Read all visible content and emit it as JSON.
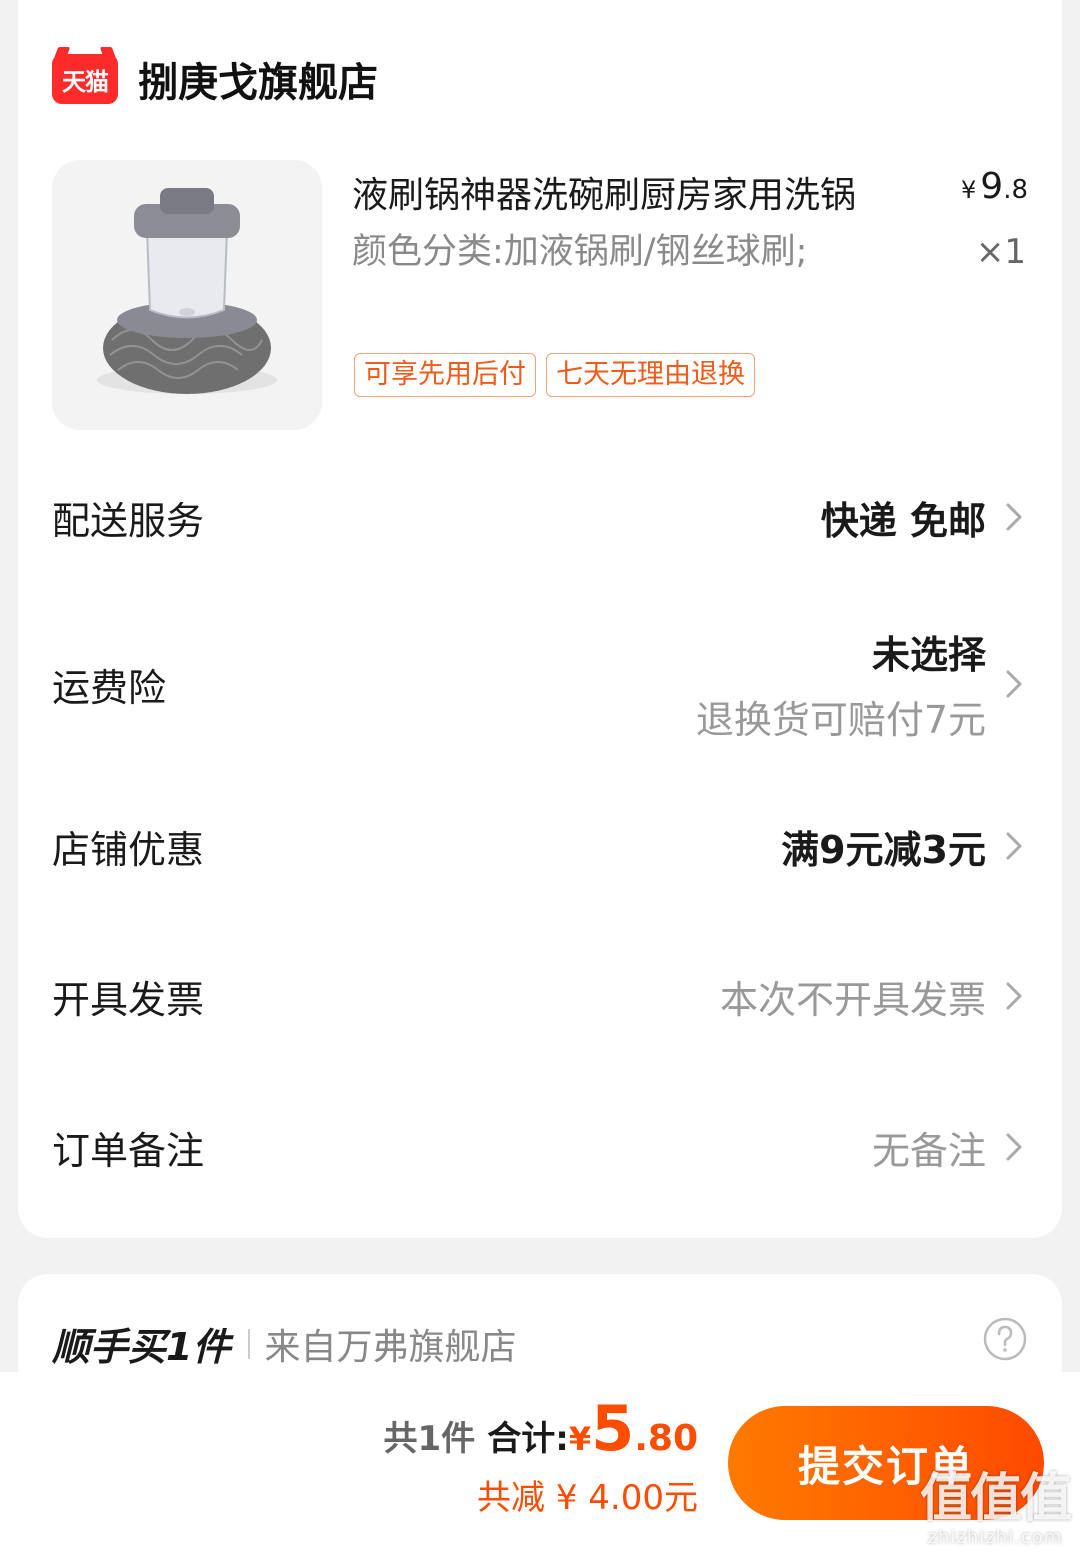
{
  "shop": {
    "logo_text": "天猫",
    "name": "捌庚戈旗舰店"
  },
  "product": {
    "title": "液刷锅神器洗碗刷厨房家用洗锅",
    "spec": "颜色分类:加液锅刷/钢丝球刷;",
    "price_yen": "¥",
    "price_int": "9",
    "price_dec": ".8",
    "quantity": "×1",
    "tags": [
      "可享先用后付",
      "七天无理由退换"
    ]
  },
  "rows": {
    "delivery": {
      "label": "配送服务",
      "value": "快递 免邮"
    },
    "freight_insurance": {
      "label": "运费险",
      "value": "未选择",
      "sub": "退换货可赔付7元"
    },
    "store_discount": {
      "label": "店铺优惠",
      "value": "满9元减3元"
    },
    "invoice": {
      "label": "开具发票",
      "value": "本次不开具发票"
    },
    "remark": {
      "label": "订单备注",
      "value": "无备注"
    }
  },
  "upsell": {
    "title": "顺手买1件",
    "from": "来自万弗旗舰店"
  },
  "summary": {
    "count": "共1件",
    "total_label": "合计:",
    "total_yen": "¥",
    "total_int": "5",
    "total_dec": ".80",
    "discount": "共减 ¥ 4.00元"
  },
  "submit": {
    "label": "提交订单"
  },
  "watermark": {
    "big": "值值值",
    "small": "zhizhizhi.com"
  },
  "colors": {
    "accent": "#ff4d00",
    "tag_border": "#f2a07e",
    "tmall_red": "#ff2a2a"
  }
}
